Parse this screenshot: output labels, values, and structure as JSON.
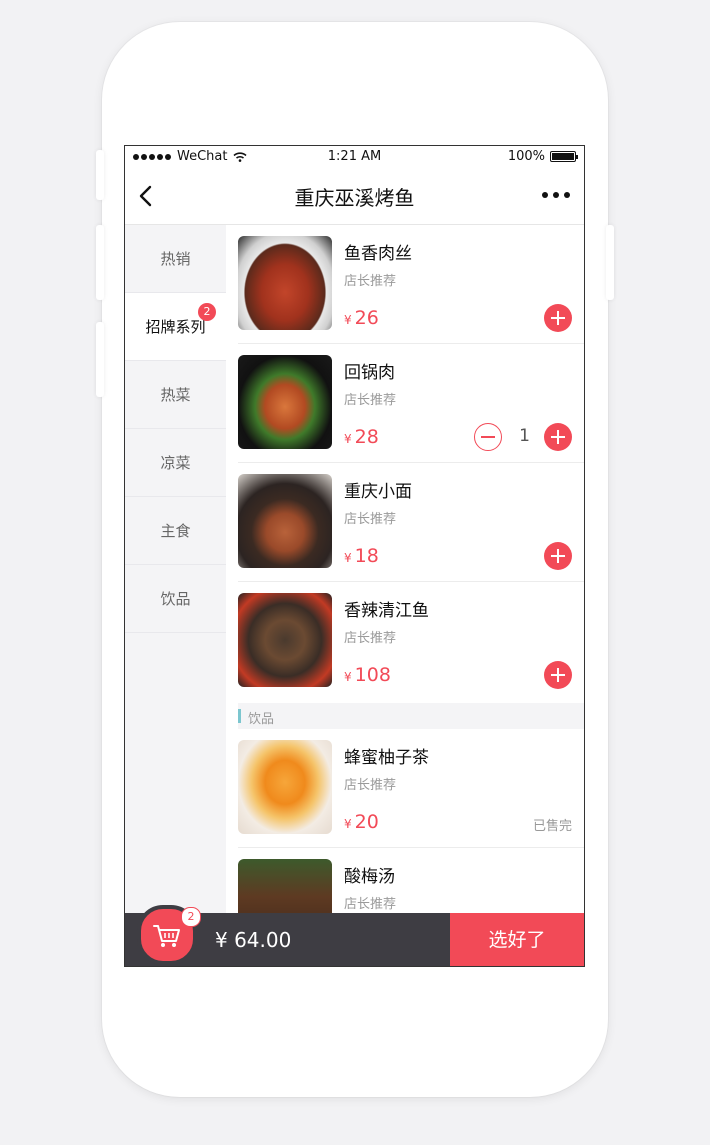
{
  "status_bar": {
    "carrier": "WeChat",
    "time": "1:21 AM",
    "battery": "100%"
  },
  "nav": {
    "title": "重庆巫溪烤鱼"
  },
  "sidebar": {
    "items": [
      {
        "label": "热销",
        "badge": ""
      },
      {
        "label": "招牌系列",
        "badge": "2",
        "active": true
      },
      {
        "label": "热菜",
        "badge": ""
      },
      {
        "label": "凉菜",
        "badge": ""
      },
      {
        "label": "主食",
        "badge": ""
      },
      {
        "label": "饮品",
        "badge": ""
      }
    ]
  },
  "menu": {
    "currency": "¥",
    "items": [
      {
        "name": "鱼香肉丝",
        "sub": "店长推荐",
        "price": "26"
      },
      {
        "name": "回锅肉",
        "sub": "店长推荐",
        "price": "28",
        "qty": "1"
      },
      {
        "name": "重庆小面",
        "sub": "店长推荐",
        "price": "18"
      },
      {
        "name": "香辣清江鱼",
        "sub": "店长推荐",
        "price": "108"
      },
      {
        "name": "蜂蜜柚子茶",
        "sub": "店长推荐",
        "price": "20",
        "status": "已售完"
      },
      {
        "name": "酸梅汤",
        "sub": "店长推荐"
      }
    ],
    "section_label": "饮品"
  },
  "cart": {
    "count": "2",
    "total": "¥ 64.00",
    "checkout_label": "选好了"
  },
  "colors": {
    "accent": "#f24a57",
    "bottom_bar": "#3e3d43",
    "sidebar_bg": "#f4f4f6"
  },
  "icons": [
    "back-arrow-icon",
    "more-icon",
    "plus-icon",
    "minus-icon",
    "cart-icon",
    "wifi-icon",
    "battery-icon"
  ]
}
